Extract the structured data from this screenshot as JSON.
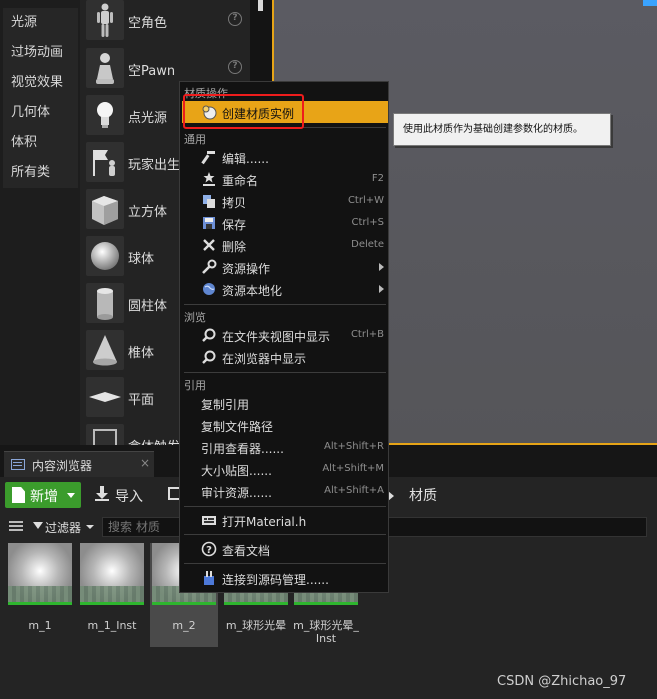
{
  "colors": {
    "accent_highlight": "#e8a417",
    "new_button_green": "#3b9c2c",
    "annotation_red": "#ee1c1c",
    "viewport_border": "#e6a417"
  },
  "categories": [
    {
      "label": "光源"
    },
    {
      "label": "过场动画"
    },
    {
      "label": "视觉效果"
    },
    {
      "label": "几何体"
    },
    {
      "label": "体积"
    },
    {
      "label": "所有类"
    }
  ],
  "place_items": [
    {
      "label": "空角色",
      "icon": "mannequin-icon",
      "help": "?"
    },
    {
      "label": "空Pawn",
      "icon": "pawn-icon",
      "help": "?"
    },
    {
      "label": "点光源",
      "icon": "lightbulb-icon"
    },
    {
      "label": "玩家出生",
      "icon": "player-start-icon"
    },
    {
      "label": "立方体",
      "icon": "cube-icon"
    },
    {
      "label": "球体",
      "icon": "sphere-icon"
    },
    {
      "label": "圆柱体",
      "icon": "cylinder-icon"
    },
    {
      "label": "椎体",
      "icon": "cone-icon"
    },
    {
      "label": "平面",
      "icon": "plane-icon"
    },
    {
      "label": "盒体触发",
      "icon": "box-trigger-icon"
    }
  ],
  "content_browser": {
    "tab_label": "内容浏览器",
    "tab_close": "×",
    "new_label": "新增",
    "import_label": "导入",
    "breadcrumb_label": "材质",
    "filter_label": "过滤器",
    "search_placeholder": "搜索 材质",
    "assets": [
      {
        "name": "m_1"
      },
      {
        "name": "m_1_Inst"
      },
      {
        "name": "m_2",
        "selected": true
      },
      {
        "name": "m_球形光晕"
      },
      {
        "name": "m_球形光晕_\nInst"
      }
    ]
  },
  "context_menu": {
    "sections": {
      "material_ops": "材质操作",
      "common": "通用",
      "browse": "浏览",
      "references": "引用"
    },
    "items": {
      "create_instance": {
        "label": "创建材质实例",
        "icon": "material-instance-icon"
      },
      "edit": {
        "label": "编辑......",
        "icon": "edit-hammer-icon"
      },
      "rename": {
        "label": "重命名",
        "shortcut": "F2",
        "icon": "rename-icon"
      },
      "copy": {
        "label": "拷贝",
        "shortcut": "Ctrl+W",
        "icon": "copy-icon"
      },
      "save": {
        "label": "保存",
        "shortcut": "Ctrl+S",
        "icon": "save-icon"
      },
      "delete": {
        "label": "删除",
        "shortcut": "Delete",
        "icon": "delete-x-icon"
      },
      "asset_actions": {
        "label": "资源操作",
        "icon": "wrench-icon"
      },
      "localize": {
        "label": "资源本地化",
        "icon": "globe-icon"
      },
      "show_in_folder": {
        "label": "在文件夹视图中显示",
        "shortcut": "Ctrl+B",
        "icon": "search-folder-icon"
      },
      "show_in_explorer": {
        "label": "在浏览器中显示",
        "icon": "search-explorer-icon"
      },
      "copy_reference": {
        "label": "复制引用"
      },
      "copy_path": {
        "label": "复制文件路径"
      },
      "ref_viewer": {
        "label": "引用查看器......",
        "shortcut": "Alt+Shift+R"
      },
      "size_map": {
        "label": "大小贴图......",
        "shortcut": "Alt+Shift+M"
      },
      "audit": {
        "label": "审计资源......",
        "shortcut": "Alt+Shift+A"
      },
      "open_header": {
        "label": "打开Material.h",
        "icon": "header-file-icon"
      },
      "docs": {
        "label": "查看文档",
        "icon": "help-icon"
      },
      "source_control": {
        "label": "连接到源码管理......",
        "icon": "source-control-icon"
      }
    }
  },
  "tooltip": {
    "text": "使用此材质作为基础创建参数化的材质。"
  },
  "watermark": "CSDN @Zhichao_97"
}
